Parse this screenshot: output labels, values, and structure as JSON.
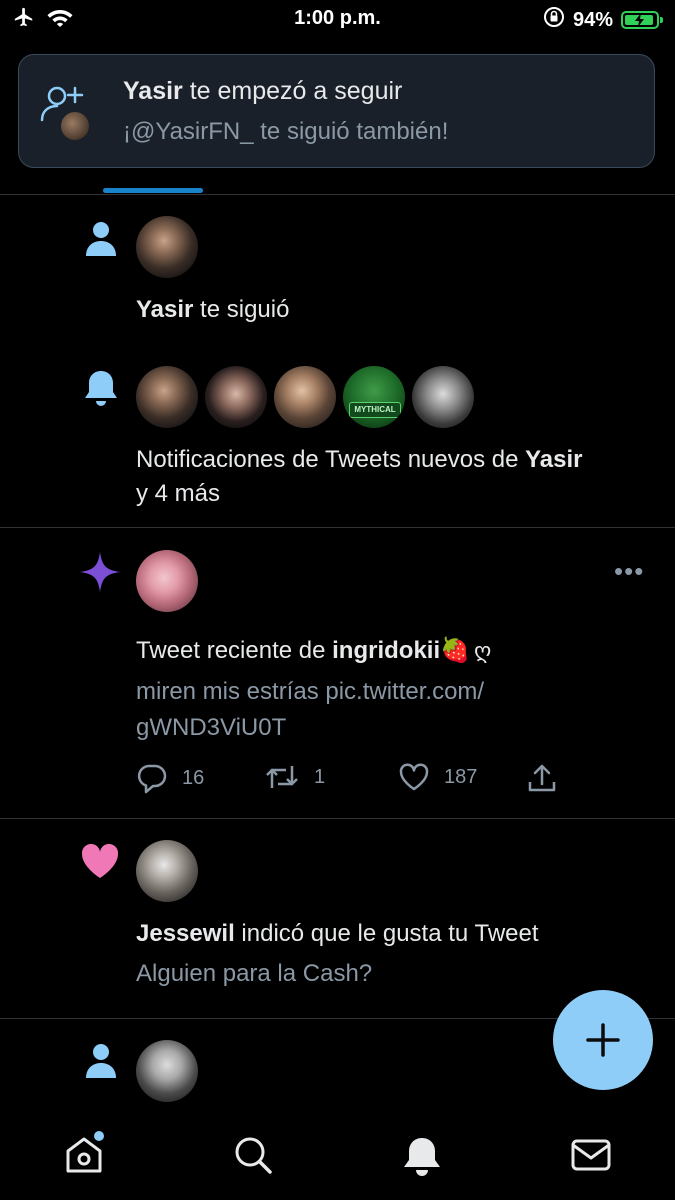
{
  "status": {
    "time": "1:00 p.m.",
    "battery_percent": "94%",
    "battery_level": 0.94,
    "icons": [
      "airplane-icon",
      "wifi-icon",
      "orientation-lock-icon",
      "battery-charging-icon"
    ]
  },
  "toast": {
    "title_name": "Yasir",
    "title_rest": " te empezó a seguir",
    "subtitle": "¡@YasirFN_ te siguió también!"
  },
  "notifications": [
    {
      "type": "follow",
      "name": "Yasir",
      "rest": " te siguió"
    },
    {
      "type": "tweet-alerts",
      "line1_pre": "Notificaciones de Tweets nuevos de ",
      "line1_name": "Yasir",
      "line2": "y 4 más",
      "avatars": [
        "avatar-1",
        "avatar-2",
        "avatar-3",
        "avatar-mythical",
        "avatar-5"
      ],
      "badge_text": "MYTHICAL"
    },
    {
      "type": "recent-tweet",
      "line1_pre": "Tweet reciente de ",
      "line1_name": "ingridokii",
      "emoji": "🍓",
      "extra_glyph": "ღ",
      "body_line1": "miren mis estrías pic.twitter.com/",
      "body_line2": "gWND3ViU0T",
      "more": "•••",
      "replies": "16",
      "retweets": "1",
      "likes": "187"
    },
    {
      "type": "like",
      "name": "Jessewil",
      "rest": " indicó que le gusta tu Tweet",
      "tweet": "Alguien para la Cash?"
    },
    {
      "type": "follow"
    }
  ],
  "colors": {
    "accent": "#1d9bf0",
    "follow_icon": "#8ecdf8",
    "sparkle": "#7b4fd6",
    "heart": "#f178b6",
    "fab": "#8ecdf8"
  },
  "nav": [
    "home-icon",
    "search-icon",
    "notifications-icon",
    "messages-icon"
  ]
}
